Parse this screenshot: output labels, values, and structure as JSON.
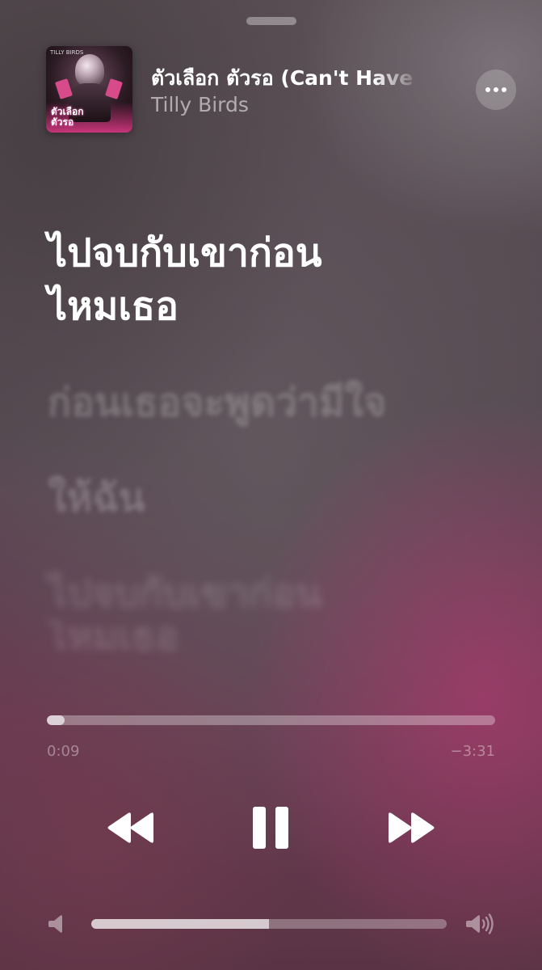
{
  "now_playing": {
    "title": "ตัวเลือก ตัวรอ (Can't Have",
    "artist": "Tilly Birds",
    "artwork": {
      "title_lines": [
        "ตัวเลือก",
        "ตัวรอ"
      ],
      "brand": "TILLY BIRDS"
    }
  },
  "lyrics": {
    "active": [
      "ไปจบกับเขาก่อน",
      "ไหมเธอ"
    ],
    "upcoming": [
      [
        "ก่อนเธอจะพูดว่ามีใจ",
        "ให้ฉัน"
      ],
      [
        "ไปจบกับเขาก่อน",
        "ไหมเธอ"
      ]
    ]
  },
  "playback": {
    "elapsed": "0:09",
    "remaining": "−3:31",
    "progress_fraction": 0.04,
    "state": "playing"
  },
  "volume": {
    "level_fraction": 0.5
  },
  "icons": {
    "more": "ellipsis-icon",
    "rewind": "rewind-icon",
    "pause": "pause-icon",
    "forward": "fast-forward-icon",
    "volume_low": "speaker-low-icon",
    "volume_high": "speaker-high-icon"
  },
  "colors": {
    "accent_pink": "#e63c8c",
    "text_primary": "#ffffff"
  }
}
